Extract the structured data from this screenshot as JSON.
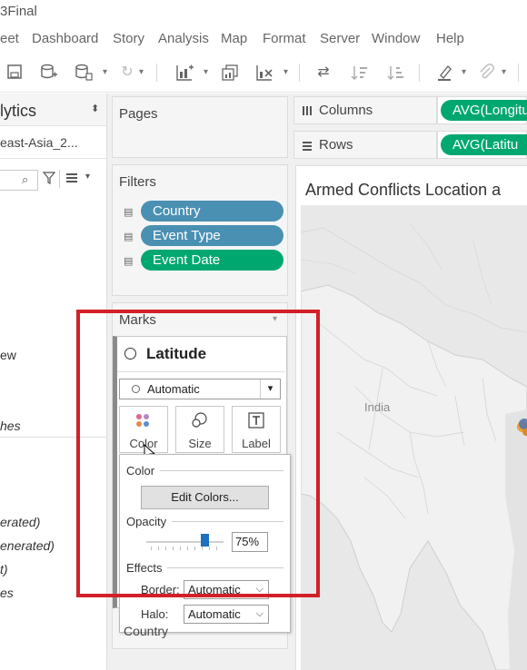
{
  "window": {
    "title": "3Final"
  },
  "menu": [
    "eet",
    "Dashboard",
    "Story",
    "Analysis",
    "Map",
    "Format",
    "Server",
    "Window",
    "Help"
  ],
  "data_pane": {
    "title": "lytics",
    "datasource": "east-Asia_2...",
    "search_placeholder": "",
    "fields": [
      "ew",
      "hes",
      "erated)",
      "enerated)",
      "t)",
      "es"
    ]
  },
  "pages": {
    "label": "Pages"
  },
  "filters": {
    "label": "Filters",
    "items": [
      {
        "label": "Country",
        "color": "#4a90b3"
      },
      {
        "label": "Event Type",
        "color": "#4a90b3"
      },
      {
        "label": "Event Date",
        "color": "#00a870"
      }
    ]
  },
  "marks": {
    "label": "Marks",
    "card_title": "Latitude",
    "mark_type": "Automatic",
    "buttons": [
      {
        "label": "Color",
        "icon": "color-dots-icon"
      },
      {
        "label": "Size",
        "icon": "size-circles-icon"
      },
      {
        "label": "Label",
        "icon": "label-T-icon"
      }
    ],
    "below_field": "Country"
  },
  "color_popup": {
    "section_color": "Color",
    "edit_colors": "Edit Colors...",
    "opacity_label": "Opacity",
    "opacity_value": "75%",
    "opacity_level": 0.75,
    "effects_label": "Effects",
    "border_label": "Border:",
    "border_value": "Automatic",
    "halo_label": "Halo:",
    "halo_value": "Automatic"
  },
  "shelves": {
    "columns_label": "Columns",
    "columns_pill": "AVG(Longitu",
    "rows_label": "Rows",
    "rows_pill": "AVG(Latitu"
  },
  "view": {
    "title": "Armed Conflicts Location a",
    "map_label": "India"
  },
  "colors": {
    "blue_pill": "#4a90b3",
    "green_pill": "#00a870",
    "highlight": "#d32028",
    "slider": "#1f6fbf"
  }
}
